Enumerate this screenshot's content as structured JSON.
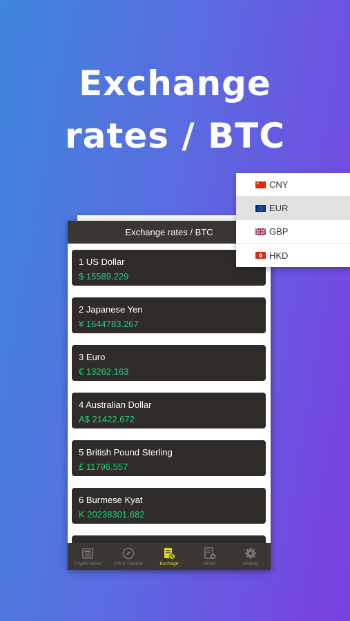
{
  "headline": {
    "line1": "Exchange",
    "line2": "rates / BTC"
  },
  "app": {
    "nav_title": "Exchange rates / BTC",
    "rates": [
      {
        "name": "1 US Dollar",
        "value": "$ 15589.229"
      },
      {
        "name": "2 Japanese Yen",
        "value": "¥ 1644783.267"
      },
      {
        "name": "3 Euro",
        "value": "€ 13262.163"
      },
      {
        "name": "4 Australian Dollar",
        "value": "A$ 21422.672"
      },
      {
        "name": "5 British Pound Sterling",
        "value": "£ 11796.557"
      },
      {
        "name": "6 Burmese Kyat",
        "value": "K 20238301.682"
      }
    ],
    "tabs": [
      {
        "label": "Crypto News",
        "icon": "newspaper-icon"
      },
      {
        "label": "Price Tracker",
        "icon": "compass-icon"
      },
      {
        "label": "Exchage",
        "icon": "exchange-icon"
      },
      {
        "label": "Notes",
        "icon": "notes-icon"
      },
      {
        "label": "Setting",
        "icon": "gear-icon"
      }
    ],
    "active_tab": "Exchage"
  },
  "dropdown": {
    "items": [
      {
        "code": "CNY",
        "flag": "china-flag-icon"
      },
      {
        "code": "EUR",
        "flag": "eu-flag-icon"
      },
      {
        "code": "GBP",
        "flag": "uk-flag-icon"
      },
      {
        "code": "HKD",
        "flag": "hong-kong-flag-icon"
      }
    ],
    "selected": "EUR"
  },
  "colors": {
    "value_green": "#1ecf7c",
    "active_tab_yellow": "#e6d51c",
    "card_bg": "#2f2b29",
    "bar_bg": "#3a3634"
  }
}
